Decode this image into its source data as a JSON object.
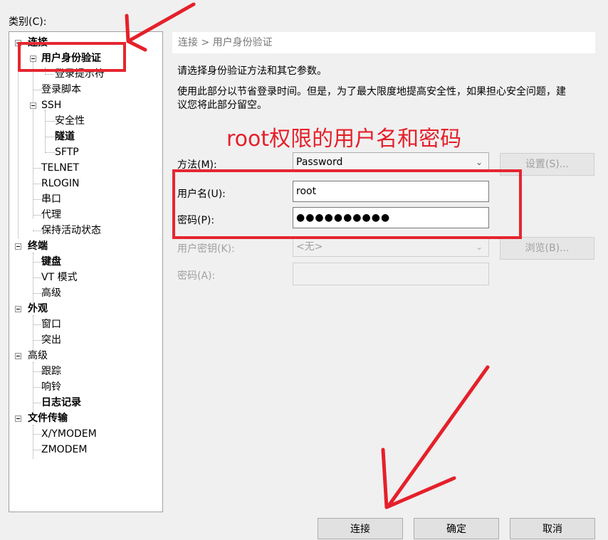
{
  "category_label": "类别(C):",
  "tree": [
    {
      "label": "连接",
      "bold": true
    },
    {
      "label": "用户身份验证",
      "bold": true
    },
    {
      "label": "登录提示符",
      "bold": false
    },
    {
      "label": "登录脚本",
      "bold": false
    },
    {
      "label": "SSH",
      "bold": false
    },
    {
      "label": "安全性",
      "bold": false
    },
    {
      "label": "隧道",
      "bold": true
    },
    {
      "label": "SFTP",
      "bold": false
    },
    {
      "label": "TELNET",
      "bold": false
    },
    {
      "label": "RLOGIN",
      "bold": false
    },
    {
      "label": "串口",
      "bold": false
    },
    {
      "label": "代理",
      "bold": false
    },
    {
      "label": "保持活动状态",
      "bold": false
    },
    {
      "label": "终端",
      "bold": true
    },
    {
      "label": "键盘",
      "bold": true
    },
    {
      "label": "VT 模式",
      "bold": false
    },
    {
      "label": "高级",
      "bold": false
    },
    {
      "label": "外观",
      "bold": true
    },
    {
      "label": "窗口",
      "bold": false
    },
    {
      "label": "突出",
      "bold": false
    },
    {
      "label": "高级",
      "bold": false
    },
    {
      "label": "跟踪",
      "bold": false
    },
    {
      "label": "响铃",
      "bold": false
    },
    {
      "label": "日志记录",
      "bold": true
    },
    {
      "label": "文件传输",
      "bold": true
    },
    {
      "label": "X/YMODEM",
      "bold": false
    },
    {
      "label": "ZMODEM",
      "bold": false
    }
  ],
  "breadcrumb": "连接 > 用户身份验证",
  "desc1": "请选择身份验证方法和其它参数。",
  "desc2_line1": "使用此部分以节省登录时间。但是，为了最大限度地提高安全性，如果担心安全问题，建",
  "desc2_line2": "议您将此部分留空。",
  "annotation": "root权限的用户名和密码",
  "form": {
    "method_label": "方法(M):",
    "method_value": "Password",
    "settings_button": "设置(S)...",
    "username_label": "用户名(U):",
    "username_value": "root",
    "password_label": "密码(P):",
    "password_value": "●●●●●●●●●●",
    "userkey_label": "用户密钥(K):",
    "userkey_value": "<无>",
    "browse_button": "浏览(B)...",
    "passphrase_label": "密码(A):"
  },
  "buttons": {
    "connect": "连接",
    "ok": "确定",
    "cancel": "取消"
  },
  "colors": {
    "annotation_red": "#e5202a"
  }
}
